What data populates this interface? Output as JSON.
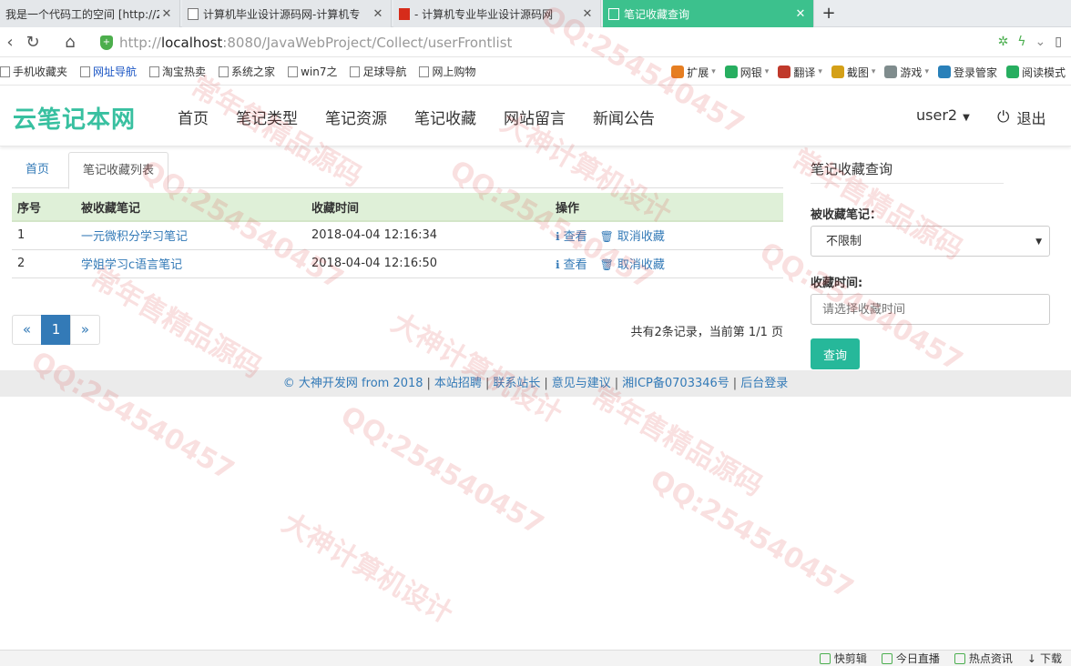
{
  "browser": {
    "tabs": [
      {
        "title": "我是一个代码工的空间 [http://2"
      },
      {
        "title": "计算机毕业设计源码网-计算机专"
      },
      {
        "title": "- 计算机专业毕业设计源码网"
      },
      {
        "title": "笔记收藏查询"
      }
    ],
    "url_prefix": "http://",
    "url_host": "localhost",
    "url_rest": ":8080/JavaWebProject/Collect/userFrontlist",
    "bookmarks": [
      "手机收藏夹",
      "网址导航",
      "淘宝热卖",
      "系统之家",
      "win7之",
      "足球导航",
      "网上购物"
    ],
    "tools": [
      {
        "label": "扩展",
        "color": "#e67e22"
      },
      {
        "label": "网银",
        "color": "#27ae60"
      },
      {
        "label": "翻译",
        "color": "#c0392b"
      },
      {
        "label": "截图",
        "color": "#d4a017"
      },
      {
        "label": "游戏",
        "color": "#7f8c8d"
      },
      {
        "label": "登录管家",
        "color": "#2980b9"
      },
      {
        "label": "阅读模式",
        "color": "#27ae60"
      }
    ]
  },
  "site": {
    "logo": "云笔记本网",
    "nav": [
      "首页",
      "笔记类型",
      "笔记资源",
      "笔记收藏",
      "网站留言",
      "新闻公告"
    ],
    "user": "user2",
    "logout": "退出"
  },
  "content": {
    "tab_home": "首页",
    "tab_current": "笔记收藏列表",
    "columns": [
      "序号",
      "被收藏笔记",
      "收藏时间",
      "操作"
    ],
    "rows": [
      {
        "no": "1",
        "note": "一元微积分学习笔记",
        "time": "2018-04-04 12:16:34",
        "view": "查看",
        "cancel": "取消收藏"
      },
      {
        "no": "2",
        "note": "学姐学习c语言笔记",
        "time": "2018-04-04 12:16:50",
        "view": "查看",
        "cancel": "取消收藏"
      }
    ],
    "pagination": {
      "prev": "«",
      "current": "1",
      "next": "»"
    },
    "page_info": "共有2条记录，当前第 1/1 页"
  },
  "query": {
    "title": "笔记收藏查询",
    "note_label": "被收藏笔记：",
    "note_value": "不限制",
    "time_label": "收藏时间:",
    "time_placeholder": "请选择收藏时间",
    "submit": "查询"
  },
  "footer": {
    "copyright": "© 大神开发网 from 2018",
    "links": [
      "本站招聘",
      "联系站长",
      "意见与建议",
      "湘ICP备0703346号",
      "后台登录"
    ]
  },
  "statusbar": [
    "快剪辑",
    "今日直播",
    "热点资讯",
    "下载"
  ],
  "watermark": [
    "QQ:254540457",
    "大神计算机设计",
    "常年售精品源码"
  ],
  "colors": {
    "accent": "#3cc18d",
    "logo": "#38c0a0",
    "link": "#337ab7",
    "header_row": "#dff0d8",
    "button": "#26b89a"
  }
}
